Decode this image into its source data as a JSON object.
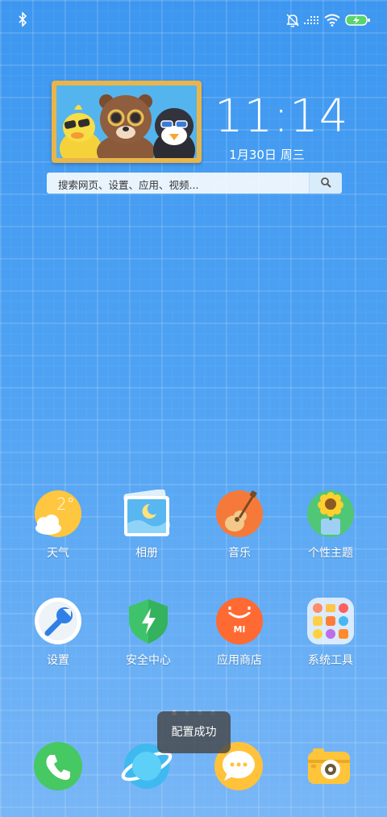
{
  "status_bar": {
    "left_icons": [
      "bluetooth-icon"
    ],
    "right_icons": [
      "silent-bell-icon",
      "signal-icon",
      "wifi-icon",
      "battery-charging-icon"
    ]
  },
  "widget": {
    "time": "11:14",
    "date": "1月30日  周三",
    "photo_icon": "cartoon-friends-photo"
  },
  "search": {
    "placeholder": "搜索网页、设置、应用、视频...",
    "button_icon": "search-icon"
  },
  "apps": [
    {
      "label": "天气",
      "icon": "weather-icon",
      "temp": "2°"
    },
    {
      "label": "相册",
      "icon": "gallery-icon"
    },
    {
      "label": "音乐",
      "icon": "music-icon"
    },
    {
      "label": "个性主题",
      "icon": "themes-icon"
    },
    {
      "label": "设置",
      "icon": "settings-icon"
    },
    {
      "label": "安全中心",
      "icon": "security-icon"
    },
    {
      "label": "应用商店",
      "icon": "app-store-icon",
      "badge_text": "MI"
    },
    {
      "label": "系统工具",
      "icon": "system-tools-folder-icon"
    }
  ],
  "page_indicator": {
    "count": 4,
    "active": 0
  },
  "toast": {
    "text": "配置成功"
  },
  "dock": [
    {
      "icon": "phone-icon"
    },
    {
      "icon": "browser-icon"
    },
    {
      "icon": "messages-icon"
    },
    {
      "icon": "camera-icon"
    }
  ],
  "colors": {
    "accent": "#3d97f0",
    "weather_sun": "#ffc63f",
    "music_orange": "#f57a3a",
    "security_green": "#3fc36a",
    "store_orange": "#ff6a33"
  }
}
